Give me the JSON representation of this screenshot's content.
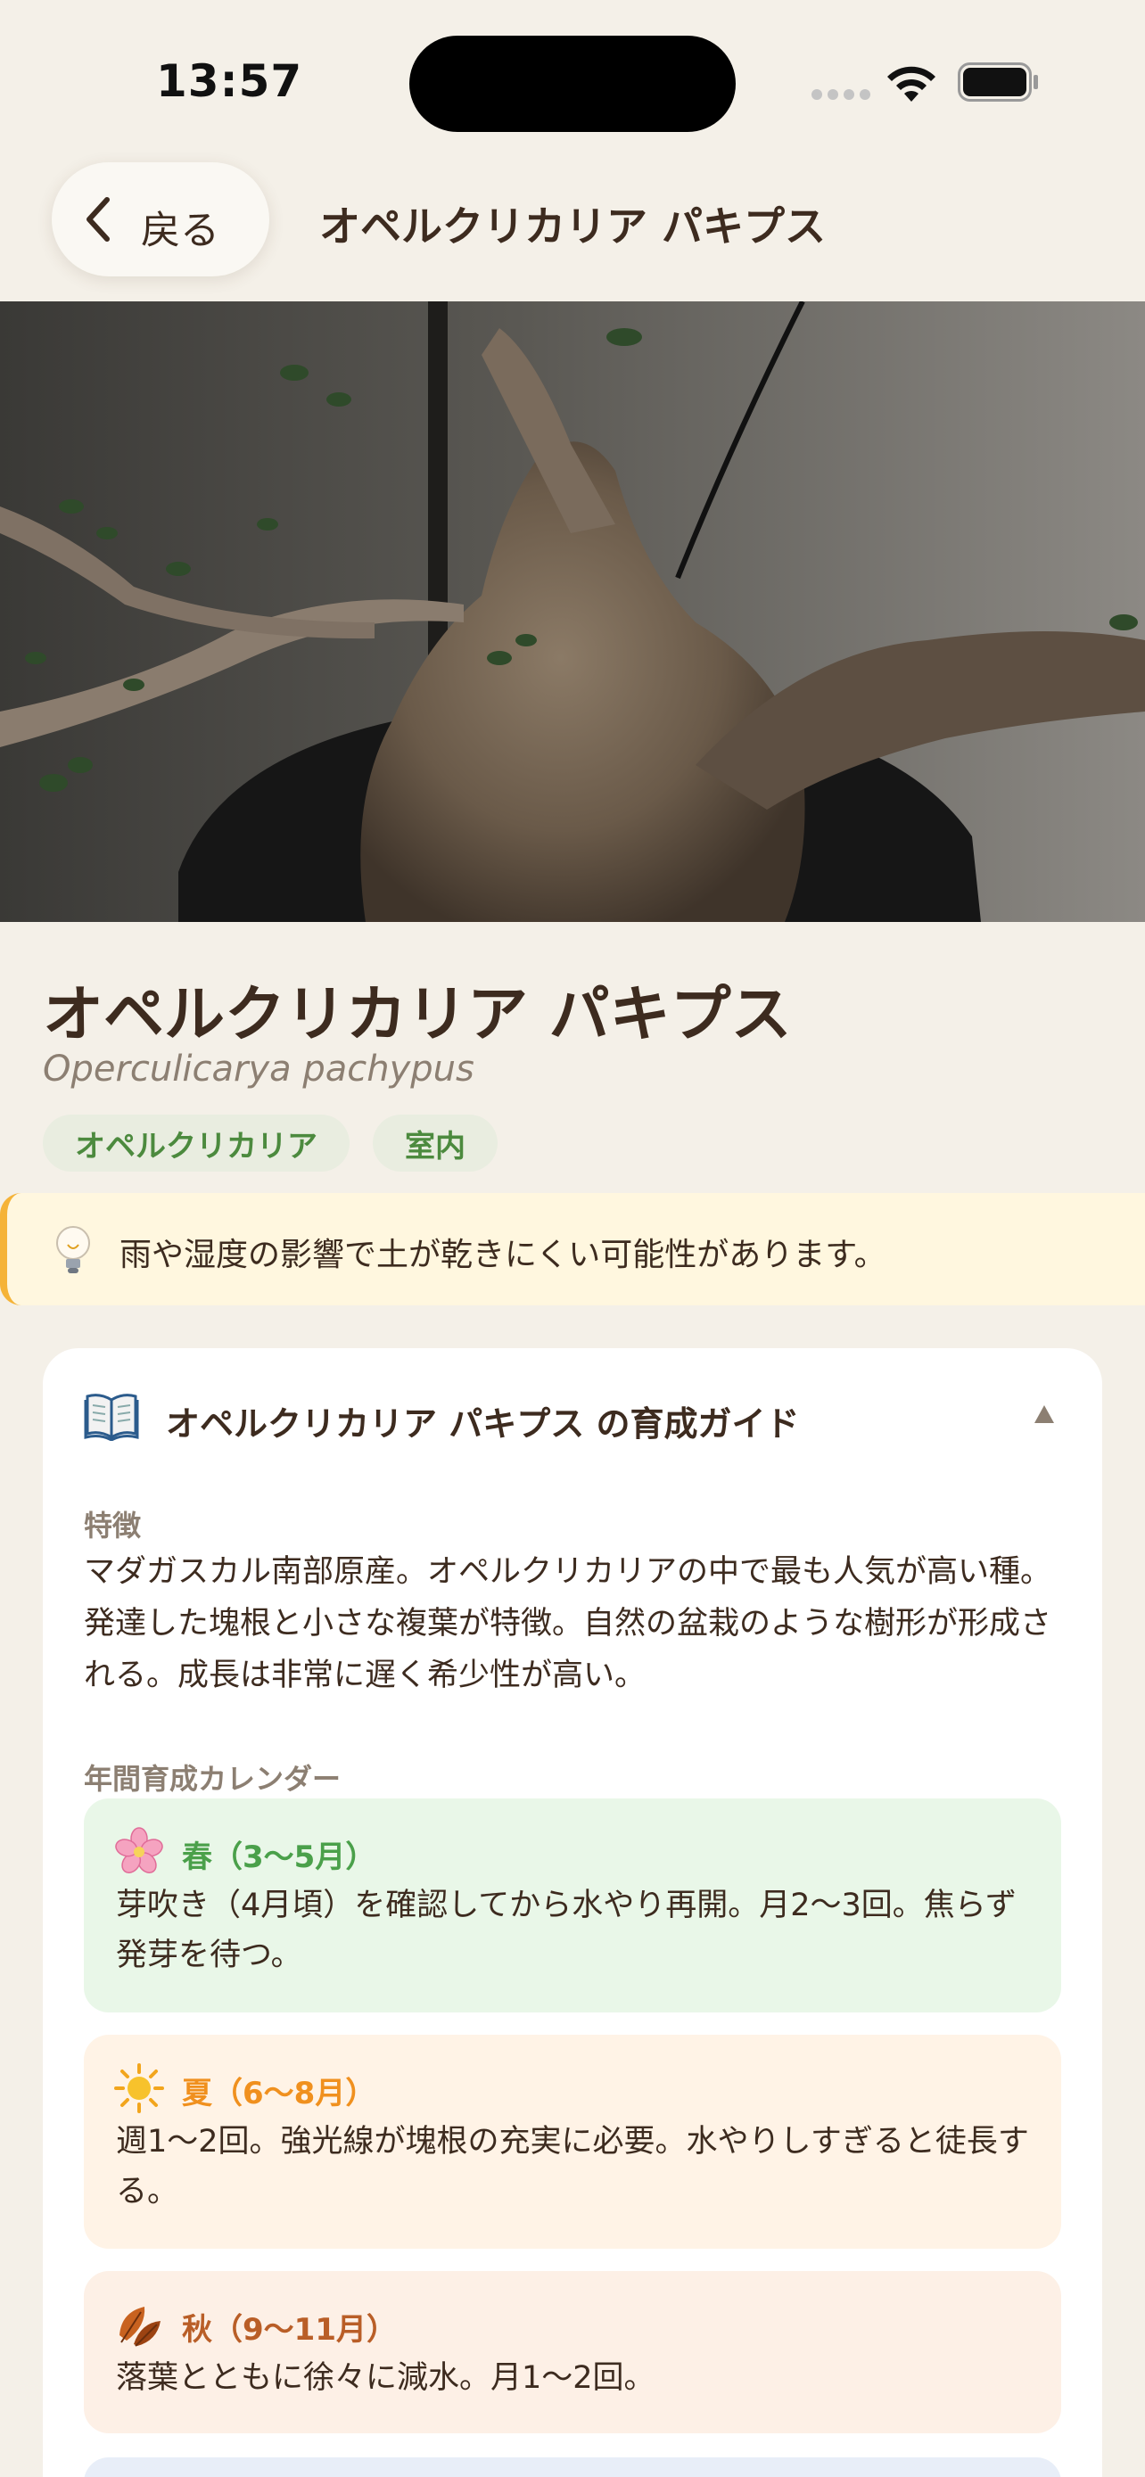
{
  "status_bar": {
    "time": "13:57"
  },
  "nav": {
    "back_label": "戻る",
    "title": "オペルクリカリア パキプス"
  },
  "plant": {
    "name": "オペルクリカリア パキプス",
    "scientific_name": "Operculicarya pachypus",
    "tags": [
      "オペルクリカリア",
      "室内"
    ]
  },
  "tip": {
    "icon": "lightbulb-icon",
    "text": "雨や湿度の影響で土が乾きにくい可能性があります。"
  },
  "guide": {
    "icon": "book-icon",
    "title": "オペルクリカリア パキプス の育成ガイド",
    "features_label": "特徴",
    "features_text": "マダガスカル南部原産。オペルクリカリアの中で最も人気が高い種。発達した塊根と小さな複葉が特徴。自然の盆栽のような樹形が形成される。成長は非常に遅く希少性が高い。",
    "calendar_label": "年間育成カレンダー",
    "seasons": [
      {
        "icon": "cherry-blossom-icon",
        "title": "春（3〜5月）",
        "text": "芽吹き（4月頃）を確認してから水やり再開。月2〜3回。焦らず発芽を待つ。",
        "color": "#4aa04a"
      },
      {
        "icon": "sun-icon",
        "title": "夏（6〜8月）",
        "text": "週1〜2回。強光線が塊根の充実に必要。水やりしすぎると徒長する。",
        "color": "#f0901e"
      },
      {
        "icon": "fallen-leaf-icon",
        "title": "秋（9〜11月）",
        "text": "落葉とともに徐々に減水。月1〜2回。",
        "color": "#b95e27"
      }
    ]
  },
  "colors": {
    "background": "#f4f0e8",
    "text": "#3d2b1f",
    "tag_green": "#4c8a3e",
    "tip_accent": "#f5b338"
  }
}
